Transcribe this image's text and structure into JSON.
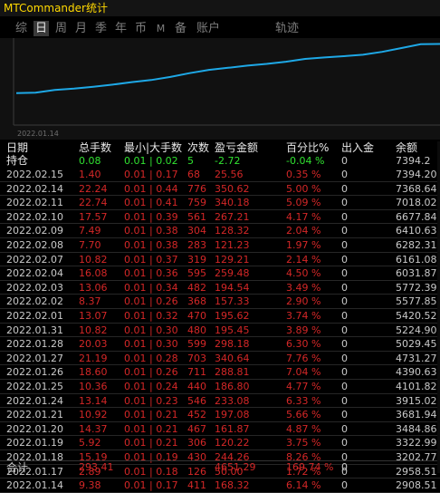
{
  "app_title": "MTCommander统计",
  "tabs": [
    {
      "label": "综",
      "active": false
    },
    {
      "label": "日",
      "active": true
    },
    {
      "label": "周",
      "active": false
    },
    {
      "label": "月",
      "active": false
    },
    {
      "label": "季",
      "active": false
    },
    {
      "label": "年",
      "active": false
    },
    {
      "label": "币",
      "active": false
    },
    {
      "label": "M",
      "active": false
    },
    {
      "label": "备",
      "active": false
    },
    {
      "label": "账户",
      "active": false
    },
    {
      "label": "轨迹",
      "active": false
    }
  ],
  "chart": {
    "x_tick_label": "2022.01.14",
    "line_color": "#1ea8e6"
  },
  "columns": {
    "date": "日期",
    "total_lots": "总手数",
    "min_max_lots": "最小|大手数",
    "count": "次数",
    "pl": "盈亏金额",
    "percent": "百分比%",
    "deposit": "出入金",
    "balance": "余额"
  },
  "holding": {
    "label": "持仓",
    "total_lots": "0.08",
    "min_max_lots": "0.01 | 0.02",
    "count": "5",
    "pl": "-2.72",
    "percent": "-0.04 %",
    "deposit": "0",
    "balance": "7394.2"
  },
  "rows": [
    {
      "date": "2022.02.15",
      "total_lots": "1.40",
      "min_max_lots": "0.01 | 0.17",
      "count": "68",
      "pl": "25.56",
      "percent": "0.35 %",
      "deposit": "0",
      "balance": "7394.20"
    },
    {
      "date": "2022.02.14",
      "total_lots": "22.24",
      "min_max_lots": "0.01 | 0.44",
      "count": "776",
      "pl": "350.62",
      "percent": "5.00 %",
      "deposit": "0",
      "balance": "7368.64"
    },
    {
      "date": "2022.02.11",
      "total_lots": "22.74",
      "min_max_lots": "0.01 | 0.41",
      "count": "759",
      "pl": "340.18",
      "percent": "5.09 %",
      "deposit": "0",
      "balance": "7018.02"
    },
    {
      "date": "2022.02.10",
      "total_lots": "17.57",
      "min_max_lots": "0.01 | 0.39",
      "count": "561",
      "pl": "267.21",
      "percent": "4.17 %",
      "deposit": "0",
      "balance": "6677.84"
    },
    {
      "date": "2022.02.09",
      "total_lots": "7.49",
      "min_max_lots": "0.01 | 0.38",
      "count": "304",
      "pl": "128.32",
      "percent": "2.04 %",
      "deposit": "0",
      "balance": "6410.63"
    },
    {
      "date": "2022.02.08",
      "total_lots": "7.70",
      "min_max_lots": "0.01 | 0.38",
      "count": "283",
      "pl": "121.23",
      "percent": "1.97 %",
      "deposit": "0",
      "balance": "6282.31"
    },
    {
      "date": "2022.02.07",
      "total_lots": "10.82",
      "min_max_lots": "0.01 | 0.37",
      "count": "319",
      "pl": "129.21",
      "percent": "2.14 %",
      "deposit": "0",
      "balance": "6161.08"
    },
    {
      "date": "2022.02.04",
      "total_lots": "16.08",
      "min_max_lots": "0.01 | 0.36",
      "count": "595",
      "pl": "259.48",
      "percent": "4.50 %",
      "deposit": "0",
      "balance": "6031.87"
    },
    {
      "date": "2022.02.03",
      "total_lots": "13.06",
      "min_max_lots": "0.01 | 0.34",
      "count": "482",
      "pl": "194.54",
      "percent": "3.49 %",
      "deposit": "0",
      "balance": "5772.39"
    },
    {
      "date": "2022.02.02",
      "total_lots": "8.37",
      "min_max_lots": "0.01 | 0.26",
      "count": "368",
      "pl": "157.33",
      "percent": "2.90 %",
      "deposit": "0",
      "balance": "5577.85"
    },
    {
      "date": "2022.02.01",
      "total_lots": "13.07",
      "min_max_lots": "0.01 | 0.32",
      "count": "470",
      "pl": "195.62",
      "percent": "3.74 %",
      "deposit": "0",
      "balance": "5420.52"
    },
    {
      "date": "2022.01.31",
      "total_lots": "10.82",
      "min_max_lots": "0.01 | 0.30",
      "count": "480",
      "pl": "195.45",
      "percent": "3.89 %",
      "deposit": "0",
      "balance": "5224.90"
    },
    {
      "date": "2022.01.28",
      "total_lots": "20.03",
      "min_max_lots": "0.01 | 0.30",
      "count": "599",
      "pl": "298.18",
      "percent": "6.30 %",
      "deposit": "0",
      "balance": "5029.45"
    },
    {
      "date": "2022.01.27",
      "total_lots": "21.19",
      "min_max_lots": "0.01 | 0.28",
      "count": "703",
      "pl": "340.64",
      "percent": "7.76 %",
      "deposit": "0",
      "balance": "4731.27"
    },
    {
      "date": "2022.01.26",
      "total_lots": "18.60",
      "min_max_lots": "0.01 | 0.26",
      "count": "711",
      "pl": "288.81",
      "percent": "7.04 %",
      "deposit": "0",
      "balance": "4390.63"
    },
    {
      "date": "2022.01.25",
      "total_lots": "10.36",
      "min_max_lots": "0.01 | 0.24",
      "count": "440",
      "pl": "186.80",
      "percent": "4.77 %",
      "deposit": "0",
      "balance": "4101.82"
    },
    {
      "date": "2022.01.24",
      "total_lots": "13.14",
      "min_max_lots": "0.01 | 0.23",
      "count": "546",
      "pl": "233.08",
      "percent": "6.33 %",
      "deposit": "0",
      "balance": "3915.02"
    },
    {
      "date": "2022.01.21",
      "total_lots": "10.92",
      "min_max_lots": "0.01 | 0.21",
      "count": "452",
      "pl": "197.08",
      "percent": "5.66 %",
      "deposit": "0",
      "balance": "3681.94"
    },
    {
      "date": "2022.01.20",
      "total_lots": "14.37",
      "min_max_lots": "0.01 | 0.21",
      "count": "467",
      "pl": "161.87",
      "percent": "4.87 %",
      "deposit": "0",
      "balance": "3484.86"
    },
    {
      "date": "2022.01.19",
      "total_lots": "5.92",
      "min_max_lots": "0.01 | 0.21",
      "count": "306",
      "pl": "120.22",
      "percent": "3.75 %",
      "deposit": "0",
      "balance": "3322.99"
    },
    {
      "date": "2022.01.18",
      "total_lots": "15.19",
      "min_max_lots": "0.01 | 0.19",
      "count": "430",
      "pl": "244.26",
      "percent": "8.26 %",
      "deposit": "0",
      "balance": "3202.77"
    },
    {
      "date": "2022.01.17",
      "total_lots": "2.89",
      "min_max_lots": "0.01 | 0.18",
      "count": "126",
      "pl": "50.00",
      "percent": "1.72 %",
      "deposit": "0",
      "balance": "2958.51"
    },
    {
      "date": "2022.01.14",
      "total_lots": "9.38",
      "min_max_lots": "0.01 | 0.17",
      "count": "411",
      "pl": "168.32",
      "percent": "6.14 %",
      "deposit": "0",
      "balance": "2908.51"
    }
  ],
  "total": {
    "label": "合计",
    "total_lots": "293.41",
    "pl": "4651.29",
    "percent": "169.74 %",
    "deposit": "0"
  }
}
